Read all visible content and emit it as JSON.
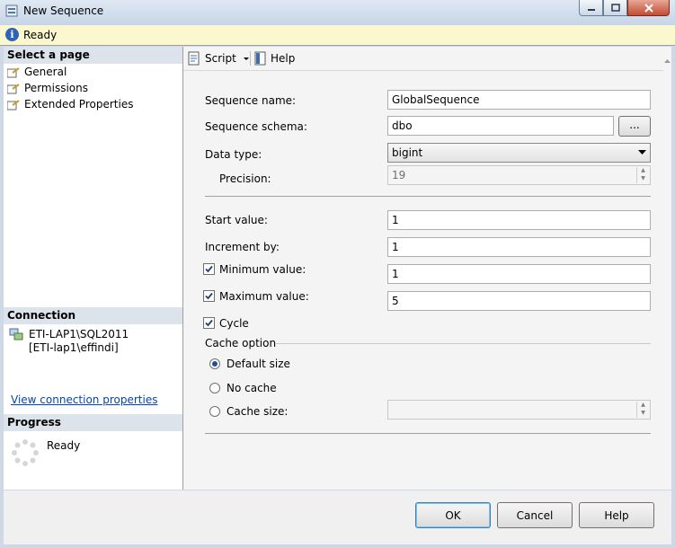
{
  "window": {
    "title": "New Sequence"
  },
  "infobar": {
    "status": "Ready"
  },
  "left": {
    "select_page_header": "Select a page",
    "pages": [
      "General",
      "Permissions",
      "Extended Properties"
    ],
    "connection_header": "Connection",
    "server": "ETI-LAP1\\SQL2011",
    "user": "[ETI-lap1\\effindi]",
    "view_connection_link": "View connection properties",
    "progress_header": "Progress",
    "progress_status": "Ready"
  },
  "toolbar": {
    "script_label": "Script",
    "help_label": "Help"
  },
  "form": {
    "sequence_name_label": "Sequence name:",
    "sequence_name_value": "GlobalSequence",
    "sequence_schema_label": "Sequence schema:",
    "sequence_schema_value": "dbo",
    "browse_label": "...",
    "data_type_label": "Data type:",
    "data_type_value": "bigint",
    "precision_label": "Precision:",
    "precision_value": "19",
    "start_value_label": "Start value:",
    "start_value": "1",
    "increment_label": "Increment by:",
    "increment_value": "1",
    "min_label": "Minimum value:",
    "min_value": "1",
    "min_checked": true,
    "max_label": "Maximum value:",
    "max_value": "5",
    "max_checked": true,
    "cycle_label": "Cycle",
    "cycle_checked": true,
    "cache_option_label": "Cache option",
    "default_size_label": "Default size",
    "no_cache_label": "No cache",
    "cache_size_label": "Cache size:",
    "cache_size_value": "",
    "selected_cache": "Default size"
  },
  "buttons": {
    "ok": "OK",
    "cancel": "Cancel",
    "help": "Help"
  },
  "colors": {
    "accent": "#2c63b8",
    "info_bg": "#fbf8cf",
    "link": "#0645ad"
  }
}
